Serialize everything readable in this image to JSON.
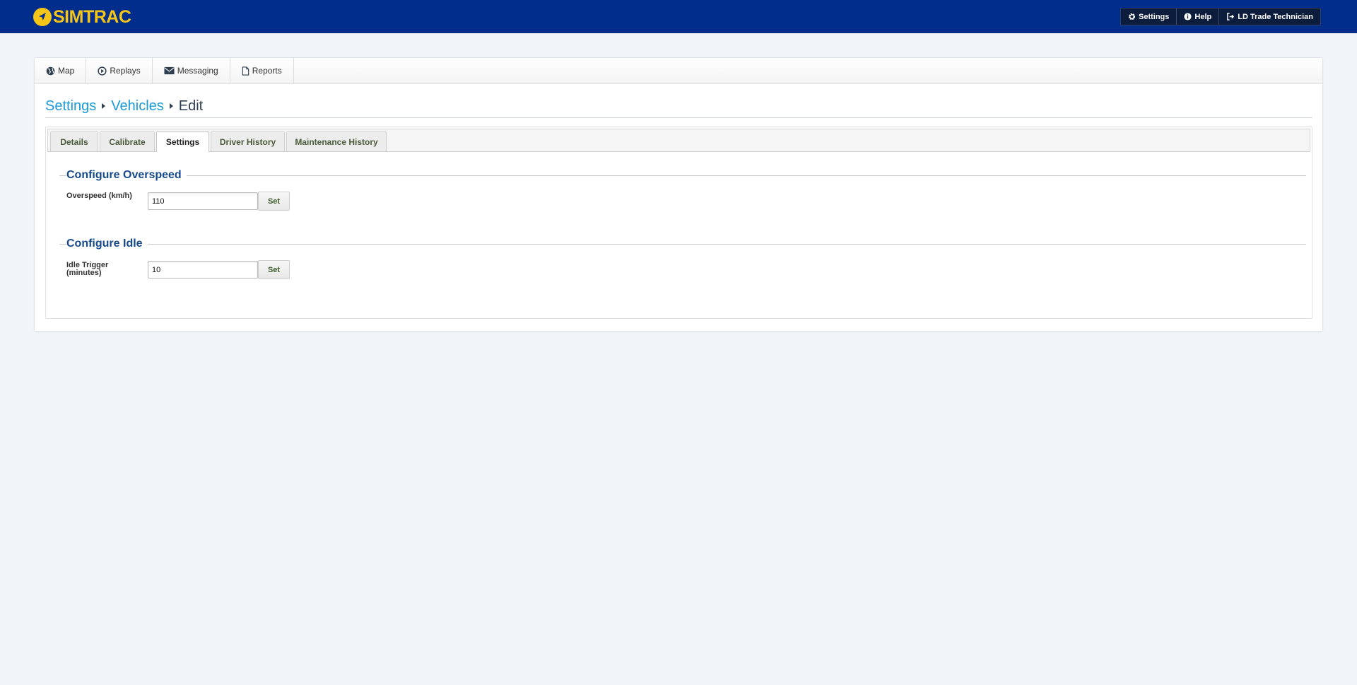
{
  "brand": {
    "name": "SIMTRAC",
    "color": "#f5c518",
    "icon": "location-arrow-icon"
  },
  "header": {
    "background": "#012d8c",
    "nav": [
      {
        "label": "Settings",
        "icon": "gear-icon"
      },
      {
        "label": "Help",
        "icon": "info-circle-icon"
      },
      {
        "label": "LD Trade Technician",
        "icon": "sign-out-icon"
      }
    ]
  },
  "main_nav": [
    {
      "label": "Map",
      "icon": "globe-icon"
    },
    {
      "label": "Replays",
      "icon": "play-circle-icon"
    },
    {
      "label": "Messaging",
      "icon": "envelope-icon"
    },
    {
      "label": "Reports",
      "icon": "document-icon"
    }
  ],
  "breadcrumb": {
    "items": [
      "Settings",
      "Vehicles"
    ],
    "current": "Edit",
    "separator_icon": "caret-right-icon",
    "link_color": "#1a9ad6"
  },
  "tabs": {
    "items": [
      "Details",
      "Calibrate",
      "Settings",
      "Driver History",
      "Maintenance History"
    ],
    "active": "Settings"
  },
  "overspeed": {
    "title": "Configure Overspeed",
    "label": "Overspeed (km/h)",
    "value": "110",
    "button": "Set"
  },
  "idle": {
    "title": "Configure Idle",
    "label_line1": "Idle Trigger",
    "label_line2": "(minutes)",
    "value": "10",
    "button": "Set"
  }
}
